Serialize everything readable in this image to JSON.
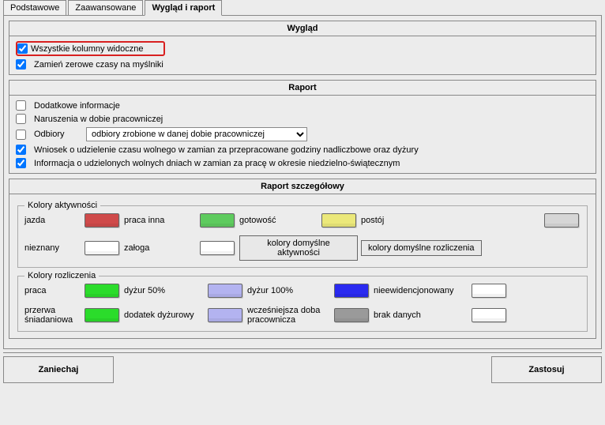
{
  "tabs": {
    "basic": "Podstawowe",
    "advanced": "Zaawansowane",
    "appearance": "Wygląd i raport"
  },
  "wyglad": {
    "header": "Wygląd",
    "all_columns_visible": "Wszystkie kolumny widoczne",
    "zero_to_dash": "Zamień zerowe czasy na myślniki"
  },
  "raport": {
    "header": "Raport",
    "extra_info": "Dodatkowe informacje",
    "violations": "Naruszenia w dobie pracowniczej",
    "pickups_label": "Odbiory",
    "pickups_selected": "odbiory zrobione w danej dobie pracowniczej",
    "request_free_time": "Wniosek o udzielenie czasu wolnego w zamian za przepracowane godziny nadliczbowe oraz dyżury",
    "days_off_info": "Informacja o udzielonych wolnych dniach w zamian za pracę w okresie niedzielno-świątecznym"
  },
  "detail": {
    "header": "Raport szczegółowy",
    "activity_legend": "Kolory aktywności",
    "settlement_legend": "Kolory rozliczenia",
    "labels": {
      "jazda": "jazda",
      "praca_inna": "praca inna",
      "gotowosc": "gotowość",
      "postoj": "postój",
      "nieznany": "nieznany",
      "zaloga": "załoga",
      "btn_default_activity": "kolory domyślne aktywności",
      "btn_default_settlement": "kolory domyślne rozliczenia",
      "praca": "praca",
      "dyzur50": "dyżur 50%",
      "dyzur100": "dyżur 100%",
      "nieewid": "nieewidencjonowany",
      "przerwa": "przerwa śniadaniowa",
      "dodatek": "dodatek dyżurowy",
      "wczesniejsza": "wcześniejsza doba pracownicza",
      "brak": "brak danych"
    },
    "colors": {
      "jazda": "#cf4a4a",
      "praca_inna": "#5ecb5e",
      "gotowosc": "#ebe87a",
      "postoj": "#d6d6d6",
      "nieznany": "#ffffff",
      "zaloga": "#ffffff",
      "praca": "#2bdc2b",
      "dyzur50": "#b3b3f0",
      "dyzur100": "#2a2af0",
      "nieewid": "#ffffff",
      "przerwa": "#2bdc2b",
      "dodatek": "#b3b3f0",
      "wczesniejsza": "#9a9a9a",
      "brak": "#ffffff"
    }
  },
  "footer": {
    "cancel": "Zaniechaj",
    "apply": "Zastosuj"
  }
}
